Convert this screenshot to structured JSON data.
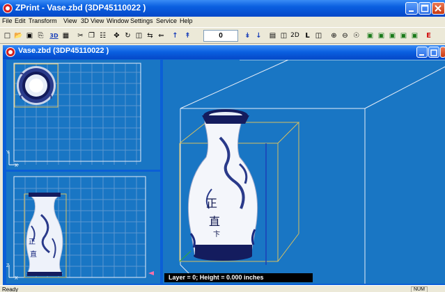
{
  "app": {
    "title": "ZPrint - Vase.zbd (3DP45110022 )"
  },
  "menu": [
    "File",
    "Edit",
    "Transform",
    "View",
    "3D View",
    "Window",
    "Settings",
    "Service",
    "Help"
  ],
  "toolbar": {
    "layer_value": "0",
    "label_3d": "3D",
    "label_2d": "2D",
    "label_L": "L",
    "label_E": "E"
  },
  "document": {
    "title": "Vase.zbd (3DP45110022 )",
    "status_layer": "Layer = 0; Height = 0.000 inches",
    "axis_y": "Y",
    "axis_x": "X",
    "axis_z": "Z",
    "vase_text_main": "正\n直\n卞",
    "vase_text_side": "正\n直"
  },
  "statusbar": {
    "text": "Ready",
    "num": "NUM"
  },
  "colors": {
    "viewport_bg": "#1976c4",
    "grid": "#5c97cf",
    "vase_blue": "#1a2a80"
  }
}
